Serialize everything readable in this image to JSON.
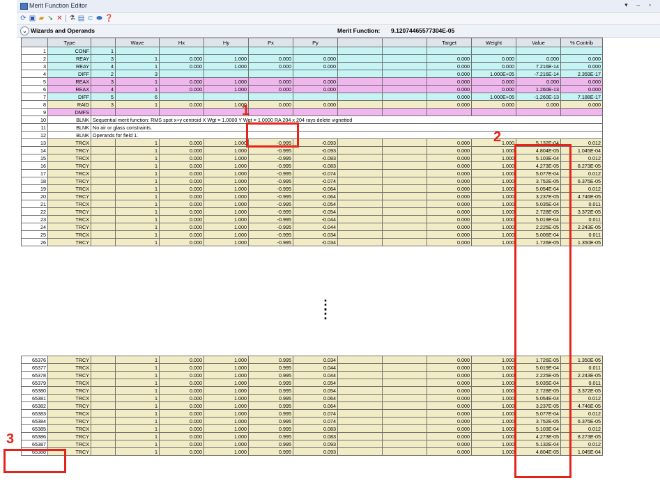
{
  "title": "Merit Function Editor",
  "window_controls": "▾ – ▫",
  "toolbar": {
    "icons": [
      "refresh-icon",
      "save-icon",
      "open-icon",
      "insert-icon",
      "delete-icon",
      "wizard-icon",
      "copy-icon",
      "link-icon",
      "toggle-icon",
      "help-icon"
    ]
  },
  "wizards_label": "Wizards and Operands",
  "merit_label": "Merit Function:",
  "merit_value": "9.12074465577304E-05",
  "columns": [
    "",
    "Type",
    "",
    "Wave",
    "Hx",
    "Hy",
    "Px",
    "Py",
    "",
    "",
    "Target",
    "Weight",
    "Value",
    "% Contrib"
  ],
  "rows_top": [
    {
      "n": "1",
      "type": "CONF",
      "c1": "1",
      "wave": "",
      "hx": "",
      "hy": "",
      "px": "",
      "py": "",
      "e1": "",
      "e2": "",
      "target": "",
      "weight": "",
      "value": "",
      "contrib": "",
      "color": "cyan"
    },
    {
      "n": "2",
      "type": "REAY",
      "c1": "3",
      "wave": "1",
      "hx": "0.000",
      "hy": "1.000",
      "px": "0.000",
      "py": "0.000",
      "e1": "",
      "e2": "",
      "target": "0.000",
      "weight": "0.000",
      "value": "0.000",
      "contrib": "0.000",
      "color": "cyan"
    },
    {
      "n": "3",
      "type": "REAY",
      "c1": "4",
      "wave": "1",
      "hx": "0.000",
      "hy": "1.000",
      "px": "0.000",
      "py": "0.000",
      "e1": "",
      "e2": "",
      "target": "0.000",
      "weight": "0.000",
      "value": "7.216E-14",
      "contrib": "0.000",
      "color": "cyan"
    },
    {
      "n": "4",
      "type": "DIFF",
      "c1": "2",
      "wave": "3",
      "hx": "",
      "hy": "",
      "px": "",
      "py": "",
      "e1": "",
      "e2": "",
      "target": "0.000",
      "weight": "1.000E+05",
      "value": "-7.216E-14",
      "contrib": "2.359E-17",
      "color": "cyan"
    },
    {
      "n": "5",
      "type": "REAX",
      "c1": "3",
      "wave": "1",
      "hx": "0.000",
      "hy": "1.000",
      "px": "0.000",
      "py": "0.000",
      "e1": "",
      "e2": "",
      "target": "0.000",
      "weight": "0.000",
      "value": "0.000",
      "contrib": "0.000",
      "color": "mag"
    },
    {
      "n": "6",
      "type": "REAX",
      "c1": "4",
      "wave": "1",
      "hx": "0.000",
      "hy": "1.000",
      "px": "0.000",
      "py": "0.000",
      "e1": "",
      "e2": "",
      "target": "0.000",
      "weight": "0.000",
      "value": "1.260E-13",
      "contrib": "0.000",
      "color": "mag"
    },
    {
      "n": "7",
      "type": "DIFF",
      "c1": "5",
      "wave": "6",
      "hx": "",
      "hy": "",
      "px": "",
      "py": "",
      "e1": "",
      "e2": "",
      "target": "0.000",
      "weight": "1.000E+05",
      "value": "-1.260E-13",
      "contrib": "7.188E-17",
      "color": "cyan"
    },
    {
      "n": "8",
      "type": "RAID",
      "c1": "3",
      "wave": "1",
      "hx": "0.000",
      "hy": "1.000",
      "px": "0.000",
      "py": "0.000",
      "e1": "",
      "e2": "",
      "target": "0.000",
      "weight": "0.000",
      "value": "0.000",
      "contrib": "0.000",
      "color": "tan"
    },
    {
      "n": "9",
      "type": "DMFS",
      "c1": "",
      "wave": "",
      "hx": "",
      "hy": "",
      "px": "",
      "py": "",
      "e1": "",
      "e2": "",
      "target": "",
      "weight": "",
      "value": "",
      "contrib": "",
      "color": "mag"
    }
  ],
  "rows_text": [
    {
      "n": "10",
      "type": "BLNK",
      "text": "Sequential merit function: RMS spot x+y centroid X Wgt = 1.0000 Y Wgt = 1.0000 RA 204 x 204 rays delete vignetted"
    },
    {
      "n": "11",
      "type": "BLNK",
      "text": "No air or glass constraints."
    },
    {
      "n": "12",
      "type": "BLNK",
      "text": "Operands for field 1."
    }
  ],
  "rows_mid": [
    {
      "n": "13",
      "type": "TRCX",
      "wave": "1",
      "hx": "0.000",
      "hy": "1.000",
      "px": "-0.995",
      "py": "-0.093",
      "target": "0.000",
      "weight": "1.000",
      "value": "5.132E-04",
      "contrib": "0.012"
    },
    {
      "n": "14",
      "type": "TRCY",
      "wave": "1",
      "hx": "0.000",
      "hy": "1.000",
      "px": "-0.995",
      "py": "-0.093",
      "target": "0.000",
      "weight": "1.000",
      "value": "4.804E-05",
      "contrib": "1.045E-04"
    },
    {
      "n": "15",
      "type": "TRCX",
      "wave": "1",
      "hx": "0.000",
      "hy": "1.000",
      "px": "-0.995",
      "py": "-0.083",
      "target": "0.000",
      "weight": "1.000",
      "value": "5.103E-04",
      "contrib": "0.012"
    },
    {
      "n": "16",
      "type": "TRCY",
      "wave": "1",
      "hx": "0.000",
      "hy": "1.000",
      "px": "-0.995",
      "py": "-0.083",
      "target": "0.000",
      "weight": "1.000",
      "value": "4.273E-05",
      "contrib": "8.273E-05"
    },
    {
      "n": "17",
      "type": "TRCX",
      "wave": "1",
      "hx": "0.000",
      "hy": "1.000",
      "px": "-0.995",
      "py": "-0.074",
      "target": "0.000",
      "weight": "1.000",
      "value": "5.077E-04",
      "contrib": "0.012"
    },
    {
      "n": "18",
      "type": "TRCY",
      "wave": "1",
      "hx": "0.000",
      "hy": "1.000",
      "px": "-0.995",
      "py": "-0.074",
      "target": "0.000",
      "weight": "1.000",
      "value": "3.752E-05",
      "contrib": "6.375E-05"
    },
    {
      "n": "19",
      "type": "TRCX",
      "wave": "1",
      "hx": "0.000",
      "hy": "1.000",
      "px": "-0.995",
      "py": "-0.064",
      "target": "0.000",
      "weight": "1.000",
      "value": "5.054E-04",
      "contrib": "0.012"
    },
    {
      "n": "20",
      "type": "TRCY",
      "wave": "1",
      "hx": "0.000",
      "hy": "1.000",
      "px": "-0.995",
      "py": "-0.064",
      "target": "0.000",
      "weight": "1.000",
      "value": "3.237E-05",
      "contrib": "4.746E-05"
    },
    {
      "n": "21",
      "type": "TRCX",
      "wave": "1",
      "hx": "0.000",
      "hy": "1.000",
      "px": "-0.995",
      "py": "-0.054",
      "target": "0.000",
      "weight": "1.000",
      "value": "5.035E-04",
      "contrib": "0.011"
    },
    {
      "n": "22",
      "type": "TRCY",
      "wave": "1",
      "hx": "0.000",
      "hy": "1.000",
      "px": "-0.995",
      "py": "-0.054",
      "target": "0.000",
      "weight": "1.000",
      "value": "2.728E-05",
      "contrib": "3.372E-05"
    },
    {
      "n": "23",
      "type": "TRCX",
      "wave": "1",
      "hx": "0.000",
      "hy": "1.000",
      "px": "-0.995",
      "py": "-0.044",
      "target": "0.000",
      "weight": "1.000",
      "value": "5.019E-04",
      "contrib": "0.011"
    },
    {
      "n": "24",
      "type": "TRCY",
      "wave": "1",
      "hx": "0.000",
      "hy": "1.000",
      "px": "-0.995",
      "py": "-0.044",
      "target": "0.000",
      "weight": "1.000",
      "value": "2.225E-05",
      "contrib": "2.243E-05"
    },
    {
      "n": "25",
      "type": "TRCX",
      "wave": "1",
      "hx": "0.000",
      "hy": "1.000",
      "px": "-0.995",
      "py": "-0.034",
      "target": "0.000",
      "weight": "1.000",
      "value": "5.006E-04",
      "contrib": "0.011"
    },
    {
      "n": "26",
      "type": "TRCY",
      "wave": "1",
      "hx": "0.000",
      "hy": "1.000",
      "px": "-0.995",
      "py": "-0.034",
      "target": "0.000",
      "weight": "1.000",
      "value": "1.726E-05",
      "contrib": "1.350E-05"
    }
  ],
  "rows_bottom": [
    {
      "n": "65376",
      "type": "TRCY",
      "wave": "1",
      "hx": "0.000",
      "hy": "1.000",
      "px": "0.995",
      "py": "0.034",
      "target": "0.000",
      "weight": "1.000",
      "value": "1.726E-05",
      "contrib": "1.350E-05"
    },
    {
      "n": "65377",
      "type": "TRCX",
      "wave": "1",
      "hx": "0.000",
      "hy": "1.000",
      "px": "0.995",
      "py": "0.044",
      "target": "0.000",
      "weight": "1.000",
      "value": "5.019E-04",
      "contrib": "0.011"
    },
    {
      "n": "65378",
      "type": "TRCY",
      "wave": "1",
      "hx": "0.000",
      "hy": "1.000",
      "px": "0.995",
      "py": "0.044",
      "target": "0.000",
      "weight": "1.000",
      "value": "2.225E-05",
      "contrib": "2.243E-05"
    },
    {
      "n": "65379",
      "type": "TRCX",
      "wave": "1",
      "hx": "0.000",
      "hy": "1.000",
      "px": "0.995",
      "py": "0.054",
      "target": "0.000",
      "weight": "1.000",
      "value": "5.035E-04",
      "contrib": "0.011"
    },
    {
      "n": "65380",
      "type": "TRCY",
      "wave": "1",
      "hx": "0.000",
      "hy": "1.000",
      "px": "0.995",
      "py": "0.054",
      "target": "0.000",
      "weight": "1.000",
      "value": "2.728E-05",
      "contrib": "3.372E-05"
    },
    {
      "n": "65381",
      "type": "TRCX",
      "wave": "1",
      "hx": "0.000",
      "hy": "1.000",
      "px": "0.995",
      "py": "0.064",
      "target": "0.000",
      "weight": "1.000",
      "value": "5.054E-04",
      "contrib": "0.012"
    },
    {
      "n": "65382",
      "type": "TRCY",
      "wave": "1",
      "hx": "0.000",
      "hy": "1.000",
      "px": "0.995",
      "py": "0.064",
      "target": "0.000",
      "weight": "1.000",
      "value": "3.237E-05",
      "contrib": "4.746E-05"
    },
    {
      "n": "65383",
      "type": "TRCX",
      "wave": "1",
      "hx": "0.000",
      "hy": "1.000",
      "px": "0.995",
      "py": "0.074",
      "target": "0.000",
      "weight": "1.000",
      "value": "5.077E-04",
      "contrib": "0.012"
    },
    {
      "n": "65384",
      "type": "TRCY",
      "wave": "1",
      "hx": "0.000",
      "hy": "1.000",
      "px": "0.995",
      "py": "0.074",
      "target": "0.000",
      "weight": "1.000",
      "value": "3.752E-05",
      "contrib": "6.375E-05"
    },
    {
      "n": "65385",
      "type": "TRCX",
      "wave": "1",
      "hx": "0.000",
      "hy": "1.000",
      "px": "0.995",
      "py": "0.083",
      "target": "0.000",
      "weight": "1.000",
      "value": "5.103E-04",
      "contrib": "0.012"
    },
    {
      "n": "65386",
      "type": "TRCY",
      "wave": "1",
      "hx": "0.000",
      "hy": "1.000",
      "px": "0.995",
      "py": "0.083",
      "target": "0.000",
      "weight": "1.000",
      "value": "4.273E-05",
      "contrib": "8.273E-05"
    },
    {
      "n": "65387",
      "type": "TRCX",
      "wave": "1",
      "hx": "0.000",
      "hy": "1.000",
      "px": "0.995",
      "py": "0.093",
      "target": "0.000",
      "weight": "1.000",
      "value": "5.132E-04",
      "contrib": "0.012"
    },
    {
      "n": "65388",
      "type": "TRCY",
      "wave": "1",
      "hx": "0.000",
      "hy": "1.000",
      "px": "0.995",
      "py": "0.093",
      "target": "0.000",
      "weight": "1.000",
      "value": "4.804E-05",
      "contrib": "1.045E-04"
    }
  ],
  "ellipsis": "⋮",
  "annotations": [
    {
      "label": "1"
    },
    {
      "label": "2"
    },
    {
      "label": "3"
    }
  ],
  "colors": {
    "accent_red": "#e4231b",
    "cyan": "#c6f3f4",
    "magenta": "#f0b7ee",
    "tan": "#f1ecc5"
  }
}
